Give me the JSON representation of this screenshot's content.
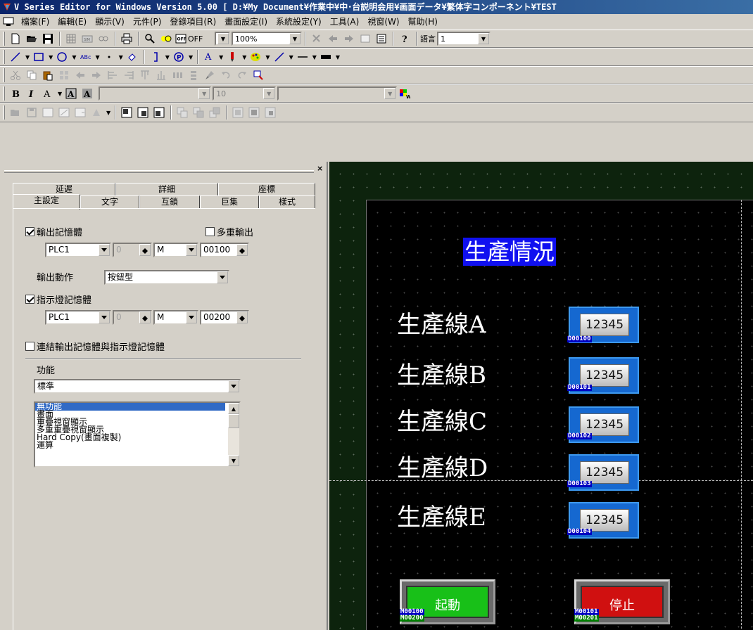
{
  "window": {
    "title": "V Series Editor for Windows Version 5.00 [ D:¥My Document¥作業中¥中･台説明会用¥画面データ¥繁体字コンポーネント¥TEST"
  },
  "menu": [
    "檔案(F)",
    "編輯(E)",
    "顯示(V)",
    "元件(P)",
    "登錄項目(R)",
    "畫面設定(I)",
    "系統設定(Y)",
    "工具(A)",
    "視窗(W)",
    "幫助(H)"
  ],
  "toolbar1": {
    "off_label": "OFF",
    "zoom": "100%",
    "language_label": "語言",
    "language_value": "1"
  },
  "toolbar4": {
    "font_size": "10"
  },
  "panel": {
    "tabs_back": [
      "延遲",
      "詳細",
      "座標"
    ],
    "tabs_front": [
      "主設定",
      "文字",
      "互鎖",
      "巨集",
      "樣式"
    ],
    "output_memory_label": "輸出記憶體",
    "output_memory_checked": true,
    "multi_output_label": "多重輸出",
    "multi_output_checked": false,
    "out_plc": "PLC1",
    "out_num": "0",
    "out_dev": "M",
    "out_addr": "00100",
    "output_action_label": "輸出動作",
    "output_action_value": "按鈕型",
    "lamp_memory_label": "指示燈記憶體",
    "lamp_memory_checked": true,
    "lamp_plc": "PLC1",
    "lamp_num": "0",
    "lamp_dev": "M",
    "lamp_addr": "00200",
    "link_label": "連結輸出記憶體與指示燈記憶體",
    "link_checked": false,
    "function_label": "功能",
    "function_value": "標準",
    "function_list": [
      "無功能",
      "畫面",
      "重疊視窗顯示",
      "多重重疊視窗顯示",
      "Hard Copy(畫面複製)",
      "運算"
    ],
    "function_selected_index": 0
  },
  "canvas": {
    "title": "生產情況",
    "lines": [
      {
        "label": "生產線A",
        "value": "12345",
        "tag": "D00100"
      },
      {
        "label": "生產線B",
        "value": "12345",
        "tag": "D00101"
      },
      {
        "label": "生產線C",
        "value": "12345",
        "tag": "D00102"
      },
      {
        "label": "生產線D",
        "value": "12345",
        "tag": "D00103"
      },
      {
        "label": "生產線E",
        "value": "12345",
        "tag": "D00104"
      }
    ],
    "start_button": {
      "label": "起動",
      "tag1": "M00100",
      "tag2": "M00200",
      "color": "#18c018"
    },
    "stop_button": {
      "label": "停止",
      "tag1": "M00101",
      "tag2": "M00201",
      "color": "#d01010"
    },
    "title_bg": "#1010f0",
    "display_frame_color": "#1568d0"
  }
}
